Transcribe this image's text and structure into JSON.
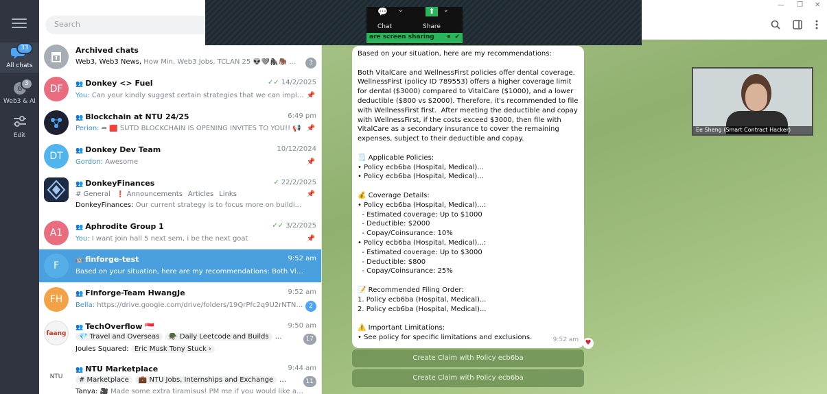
{
  "rail": {
    "items": [
      {
        "label": "All chats",
        "badge": "33",
        "icon": "chat-bubbles-icon"
      },
      {
        "label": "Web3 & AI",
        "badge": "3",
        "icon": "folder-icon"
      },
      {
        "label": "Edit",
        "icon": "sliders-icon"
      }
    ]
  },
  "search": {
    "placeholder": "Search"
  },
  "chats": [
    {
      "name": "Archived chats",
      "preview_bold": "Web3, Web3 News,",
      "preview": " How Min, Web3 Jobs, TCLAN 25 👽🩶🦍🦣 ...",
      "count": "3"
    },
    {
      "name": "Donkey <> Fuel",
      "time": "14/2/2025",
      "sender": "You:",
      "preview": " Can your kindly suggest certain strategies that we can impleme...",
      "initials": "DF"
    },
    {
      "name": "Blockchain at NTU 24/25",
      "time": "6:49 pm",
      "sender": "Perion:",
      "preview": " ➦ 🟥 SUTD BLOCKCHAIN IS OPENING INVITES TO YOU!! 📢"
    },
    {
      "name": "Donkey Dev Team",
      "time": "10/12/2024",
      "sender": "Gordon:",
      "preview": " Awesome",
      "initials": "DT"
    },
    {
      "name": "DonkeyFinances",
      "time": "22/2/2025",
      "topics": [
        "# General",
        "❗ Announcements",
        "Articles",
        "Links"
      ],
      "sender_plain": "DonkeyFinances:",
      "preview": " Our current strategy is to focus more on building t..."
    },
    {
      "name": "Aphrodite Group 1",
      "time": "3/2/2025",
      "sender": "You:",
      "preview": " I want join hall 5 next sem, i be the next goat",
      "initials": "A1"
    },
    {
      "name": "finforge-test",
      "time": "9:52 am",
      "preview": "Based on your situation, here are my recommendations:  Both VitalCare...",
      "initials": "F"
    },
    {
      "name": "Finforge-Team HwangJe",
      "time": "9:52 am",
      "sender": "Bella:",
      "preview": " https://drive.google.com/drive/folders/19QrPfc2q9U2rNTNXhk...",
      "initials": "FH",
      "count": "2"
    },
    {
      "name": "TechOverflow 🇸🇬",
      "time": "9:50 am",
      "topics": [
        "💎 Travel and Overseas",
        "🪖 Daily Leetcode and Builds",
        "🔥 Techn..."
      ],
      "sender_plain": "Joules Squared:",
      "preview": "Eric Musk Tony Stuck ›",
      "count": "17"
    },
    {
      "name": "NTU Marketplace",
      "time": "9:44 am",
      "topics": [
        "# Marketplace",
        "💼 NTU Jobs, Internships and Exchange",
        "Lost & F..."
      ],
      "sender_plain": "Tanya:",
      "preview": " 🎥 Made some extra tiramisus! PM me if you would like an...",
      "initials": "NTU",
      "count": "11"
    }
  ],
  "share": {
    "chat_label": "Chat",
    "share_label": "Share",
    "banner": "are screen sharing"
  },
  "message": {
    "text": "Based on your situation, here are my recommendations:\n\nBoth VitalCare and WellnessFirst policies offer dental coverage. WellnessFirst (policy ID 789553) offers a higher coverage limit for dental ($3000) compared to VitalCare ($1000), and a lower deductible ($800 vs $2000). Therefore, it's recommended to file with WellnessFirst first.  After meeting the deductible and copay with WellnessFirst, if the costs exceed $3000, then file with VitalCare as a secondary insurance to cover the remaining expenses, subject to their deductible and copay.\n\n🗒️ Applicable Policies:\n• Policy ecb6ba (Hospital, Medical)...\n• Policy ecb6ba (Hospital, Medical)...\n\n💰 Coverage Details:\n• Policy ecb6ba (Hospital, Medical)...:\n  - Estimated coverage: Up to $1000\n  - Deductible: $2000\n  - Copay/Coinsurance: 10%\n• Policy ecb6ba (Hospital, Medical)...:\n  - Estimated coverage: Up to $3000\n  - Deductible: $800\n  - Copay/Coinsurance: 25%\n\n📝 Recommended Filing Order:\n1. Policy ecb6ba (Hospital, Medical)...\n2. Policy ecb6ba (Hospital, Medical)...\n\n⚠️ Important Limitations:\n• See policy for specific limitations and exclusions.",
    "time": "9:52 am",
    "reaction": "♥"
  },
  "buttons": [
    "Create Claim with Policy ecb6ba",
    "Create Claim with Policy ecb6ba"
  ],
  "video": {
    "caption": "Ee Sheng (Smart Contract Hacker)"
  },
  "colors": {
    "accent": "#4a9fde",
    "rail": "#2f3440",
    "chat_bg": "#9dbb7e"
  }
}
